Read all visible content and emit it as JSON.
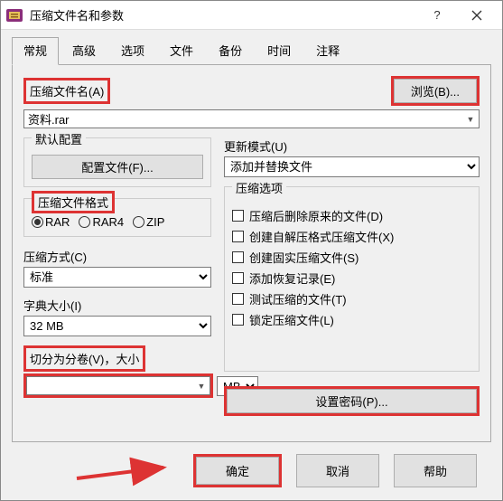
{
  "window": {
    "title": "压缩文件名和参数"
  },
  "tabs": [
    "常规",
    "高级",
    "选项",
    "文件",
    "备份",
    "时间",
    "注释"
  ],
  "active_tab": 0,
  "filename": {
    "label": "压缩文件名(A)",
    "value": "资料.rar",
    "browse": "浏览(B)..."
  },
  "default_profile": {
    "legend": "默认配置",
    "button": "配置文件(F)..."
  },
  "update_mode": {
    "label": "更新模式(U)",
    "value": "添加并替换文件"
  },
  "archive_format": {
    "legend": "压缩文件格式",
    "options": [
      "RAR",
      "RAR4",
      "ZIP"
    ],
    "selected": 0
  },
  "compression_method": {
    "label": "压缩方式(C)",
    "value": "标准"
  },
  "dict_size": {
    "label": "字典大小(I)",
    "value": "32 MB"
  },
  "split": {
    "label": "切分为分卷(V)，大小",
    "value": "",
    "unit": "MB"
  },
  "compress_options": {
    "legend": "压缩选项",
    "items": [
      "压缩后删除原来的文件(D)",
      "创建自解压格式压缩文件(X)",
      "创建固实压缩文件(S)",
      "添加恢复记录(E)",
      "测试压缩的文件(T)",
      "锁定压缩文件(L)"
    ]
  },
  "set_password": "设置密码(P)...",
  "footer": {
    "ok": "确定",
    "cancel": "取消",
    "help": "帮助"
  }
}
